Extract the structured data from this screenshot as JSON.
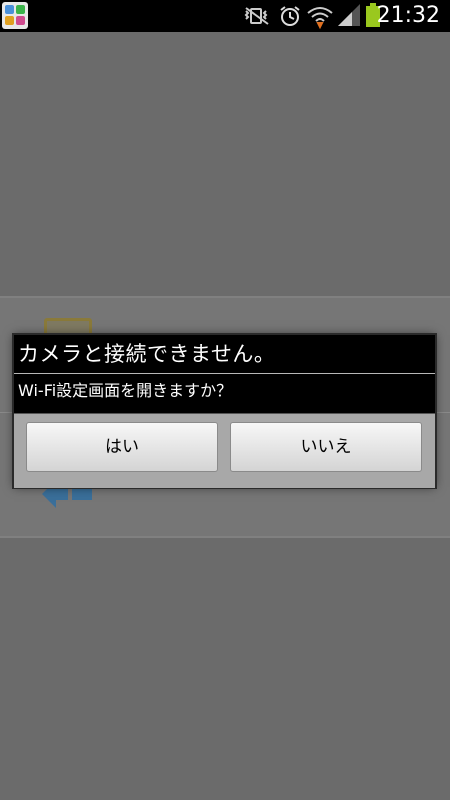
{
  "status_bar": {
    "time": "21:32",
    "icons": [
      "app-notification-icon",
      "vibrate-off-icon",
      "alarm-clock-icon",
      "wifi-icon",
      "signal-icon",
      "battery-charging-icon"
    ],
    "battery_color": "#9ac81e"
  },
  "dialog": {
    "title": "カメラと接続できません。",
    "message": "Wi-Fi設定画面を開きますか？",
    "buttons": {
      "yes_label": "はい",
      "no_label": "いいえ"
    }
  },
  "colors": {
    "dim_background": "#6b6b6b",
    "dialog_background": "#000000",
    "button_bar": "#a8a8a8"
  }
}
